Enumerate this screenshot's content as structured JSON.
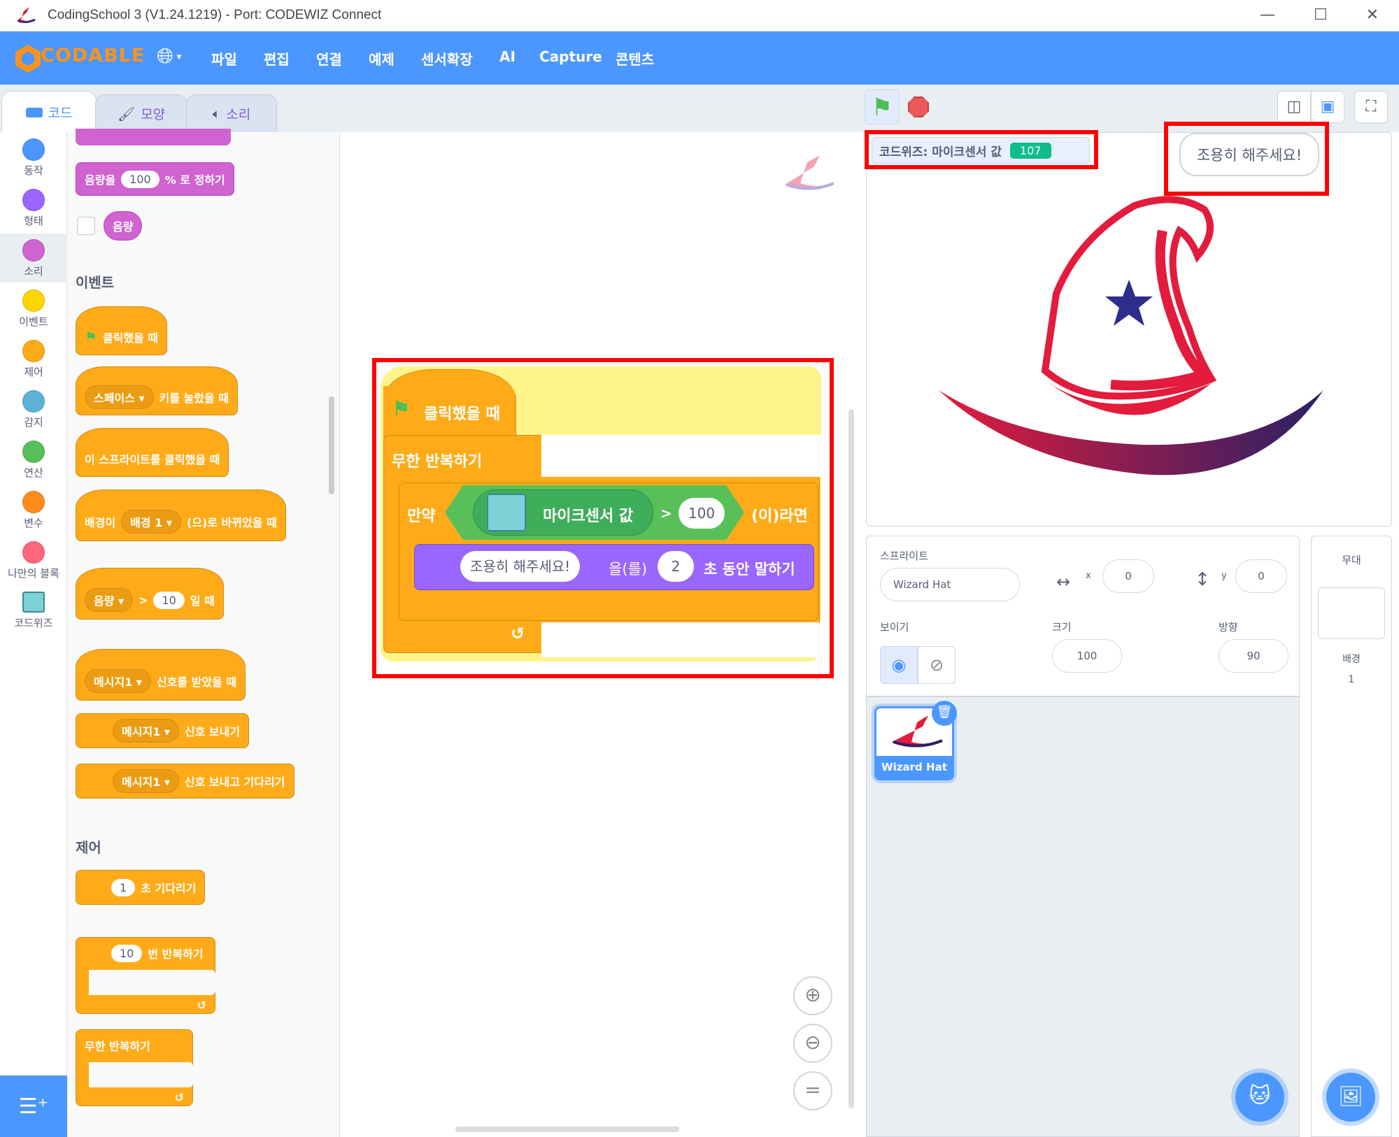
{
  "window": {
    "title": "CodingSchool 3 (V1.24.1219) - Port: CODEWIZ Connect",
    "minimize": "—",
    "maximize": "☐",
    "close": "✕"
  },
  "menubar": {
    "brand": "CODABLE",
    "items": [
      "파일",
      "편집",
      "연결",
      "예제",
      "센서확장",
      "AI",
      "Capture",
      "콘텐츠"
    ]
  },
  "tabs": {
    "code": "코드",
    "costume": "모양",
    "sound": "소리"
  },
  "categories": [
    {
      "label": "동작",
      "color": "#4c97ff"
    },
    {
      "label": "형태",
      "color": "#9966ff"
    },
    {
      "label": "소리",
      "color": "#cf63cf"
    },
    {
      "label": "이벤트",
      "color": "#ffd500"
    },
    {
      "label": "제어",
      "color": "#ffab19"
    },
    {
      "label": "감지",
      "color": "#5cb1d6"
    },
    {
      "label": "연산",
      "color": "#59c059"
    },
    {
      "label": "변수",
      "color": "#ff8c1a"
    },
    {
      "label": "나만의 블록",
      "color": "#ff6680"
    },
    {
      "label": "코드위즈",
      "color": "#4c97ff"
    }
  ],
  "palette": {
    "volume_set": {
      "a": "음량을",
      "val": "100",
      "b": "% 로 정하기"
    },
    "volume_reporter": "음량",
    "events_title": "이벤트",
    "when_flag": "클릭했을 때",
    "when_key": {
      "key": "스페이스",
      "b": "키를 눌렀을 때"
    },
    "when_sprite_clicked": "이 스프라이트를 클릭했을 때",
    "when_backdrop": {
      "a": "배경이",
      "dd": "배경 1",
      "b": "(으)로 바뀌었을 때"
    },
    "when_greater": {
      "dd": "음량",
      "op": ">",
      "val": "10",
      "b": "일 때"
    },
    "when_receive": {
      "dd": "메시지1",
      "b": "신호를 받았을 때"
    },
    "broadcast": {
      "dd": "메시지1",
      "b": "신호 보내기"
    },
    "broadcast_wait": {
      "dd": "메시지1",
      "b": "신호 보내고 기다리기"
    },
    "control_title": "제어",
    "wait": {
      "val": "1",
      "b": "초 기다리기"
    },
    "repeat": {
      "val": "10",
      "b": "번 반복하기"
    },
    "forever": "무한 반복하기"
  },
  "script": {
    "hat": "클릭했을 때",
    "forever": "무한 반복하기",
    "if": "만약",
    "sensor": "마이크센서 값",
    "op": ">",
    "threshold": "100",
    "then": "(이)라면",
    "say_text": "조용히 해주세요!",
    "say_a": "을(를)",
    "say_secs": "2",
    "say_b": "초 동안 말하기"
  },
  "stage": {
    "monitor_label": "코드위즈: 마이크센서 값",
    "monitor_value": "107",
    "speech": "조용히 해주세요!"
  },
  "sprite_info": {
    "header": "스프라이트",
    "name": "Wizard Hat",
    "x_label": "x",
    "x": "0",
    "y_label": "y",
    "y": "0",
    "show_label": "보이기",
    "size_label": "크기",
    "size": "100",
    "direction_label": "방향",
    "direction": "90"
  },
  "sprite_list": [
    {
      "name": "Wizard Hat"
    }
  ],
  "stage_panel": {
    "title": "무대",
    "backdrops_label": "배경",
    "backdrops_count": "1"
  },
  "colors": {
    "menubar": "#4c97ff",
    "events": "#ffab19",
    "sound": "#cf63cf",
    "operator": "#59c059",
    "looks": "#9966ff",
    "highlight": "#ff0000"
  }
}
